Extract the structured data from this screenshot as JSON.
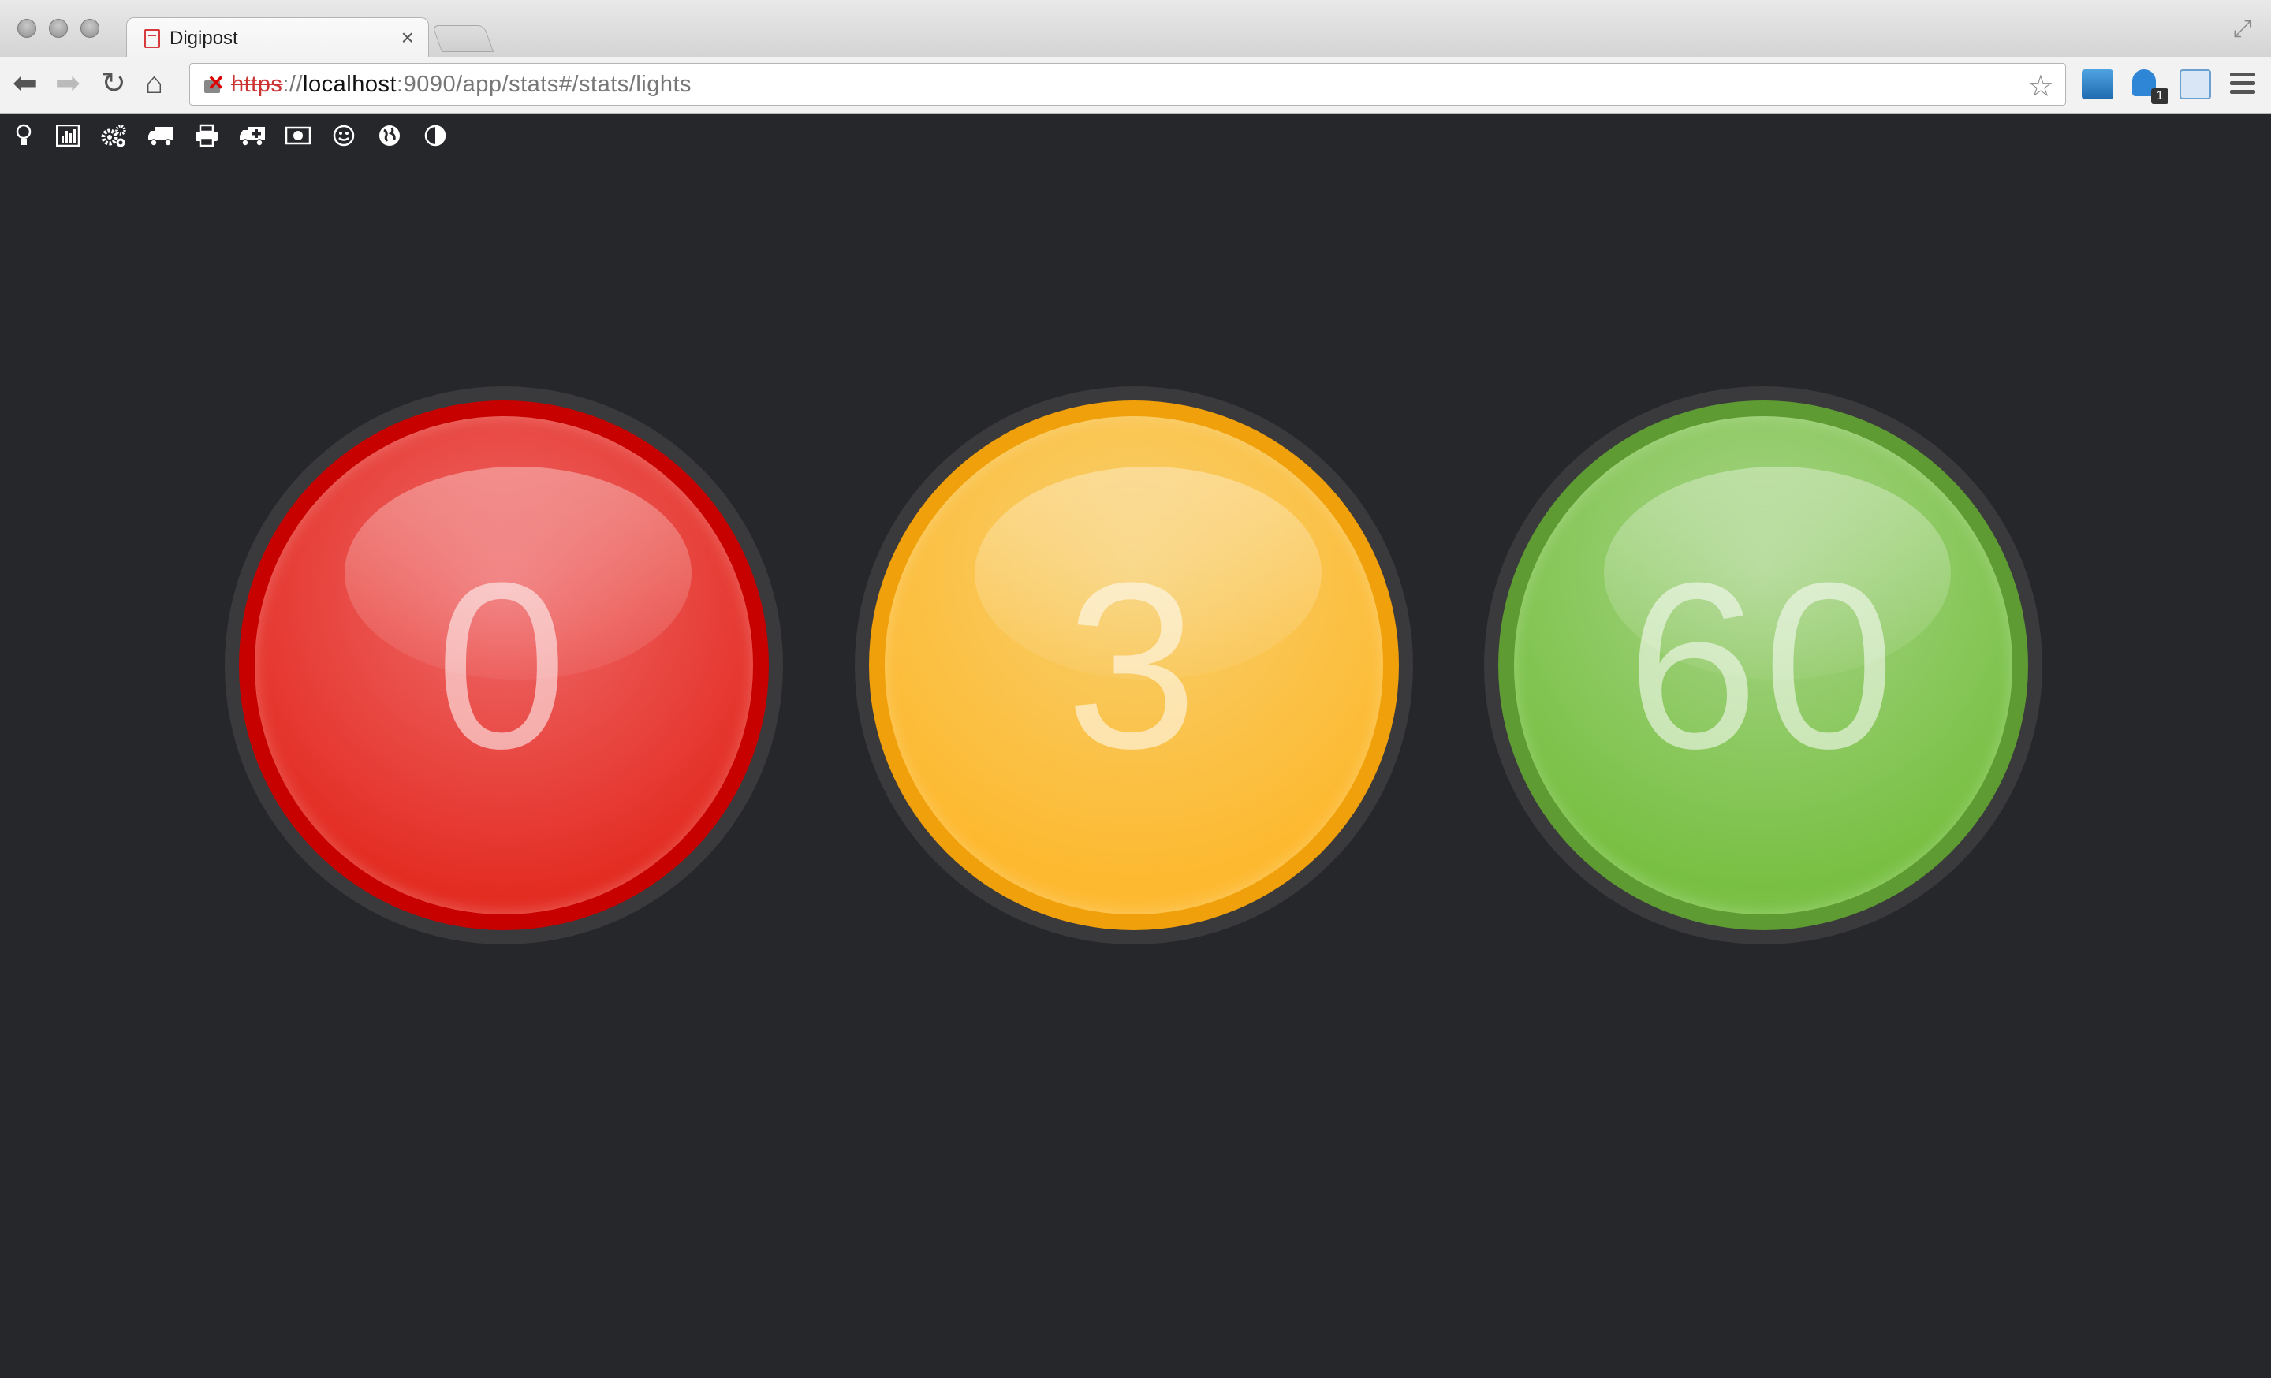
{
  "browser": {
    "tab_title": "Digipost",
    "tab_close": "×",
    "url_scheme": "https",
    "url_sep": "://",
    "url_host": "localhost",
    "url_rest": ":9090/app/stats#/stats/lights",
    "ext_badge": "1"
  },
  "nav": {
    "icons": [
      "lightbulb-icon",
      "bar-chart-icon",
      "gears-icon",
      "truck-icon",
      "print-icon",
      "ambulance-icon",
      "money-icon",
      "smiley-icon",
      "globe-icon",
      "adjust-icon"
    ]
  },
  "lights": [
    {
      "color": "red",
      "value": "0"
    },
    {
      "color": "yellow",
      "value": "3"
    },
    {
      "color": "green",
      "value": "60"
    }
  ],
  "colors": {
    "background": "#26272b",
    "red": "#e32c22",
    "yellow": "#fdb92f",
    "green": "#78c043"
  }
}
